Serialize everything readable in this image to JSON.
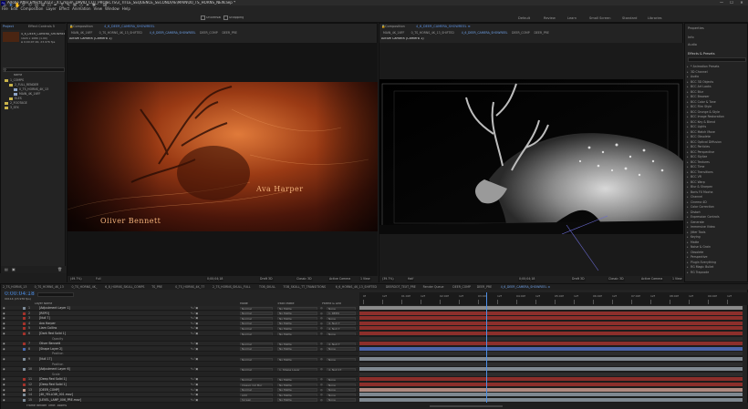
{
  "titlebar": {
    "title": "Adobe After Effects 2023 - X:\\_main\\_DAVID_CUT_PROJECTS\\3_TITLE_SEQUENCE_SECOND\\AE\\MAIN\\00_TS_HORNS_NEW.aep *",
    "icon": "Ae",
    "minimize": "—",
    "maximize": "☐",
    "close": "✕"
  },
  "menu": [
    "File",
    "Edit",
    "Composition",
    "Layer",
    "Effect",
    "Animation",
    "View",
    "Window",
    "Help"
  ],
  "toolbar": {
    "snapping": "Snapping",
    "universal": "Universal"
  },
  "workspaces": [
    "Default",
    "Review",
    "Learn",
    "Small Screen",
    "Standard",
    "Libraries"
  ],
  "project": {
    "tabs": [
      "Project",
      "Effect Controls 5"
    ],
    "comp_name": "4_6_DEER_CAMERA_SHOWREEL",
    "comp_info": "1920 x 1080 (1.00)",
    "comp_info2": "Δ 0;00;07;00, 23.976 fps",
    "search": "",
    "column": "Name",
    "items": [
      {
        "name": "1_COMPS",
        "color": "#c9b34a",
        "indent": 0
      },
      {
        "name": "2_FULL_RENDER",
        "color": "#c9b34a",
        "indent": 1
      },
      {
        "name": "0_TS_HORNS_4K_13",
        "color": "#8ea3c6",
        "indent": 2
      },
      {
        "name": "MAIN_4K_16FF",
        "color": "#8ea3c6",
        "indent": 2
      },
      {
        "name": "ELES",
        "color": "#c9b34a",
        "indent": 1
      },
      {
        "name": "2_FOOTAGE",
        "color": "#c9b34a",
        "indent": 0
      },
      {
        "name": "3_SFX",
        "color": "#c9b34a",
        "indent": 0
      }
    ]
  },
  "viewer_left": {
    "header": "Composition",
    "header_comp": "4_6_DEER_CAMERA_SHOWREEL",
    "tabs": [
      "MAIN_4K_16FF",
      "0_TS_HORNS_4K_13_SHIFTED",
      "4_6_DEER_CAMERA_SHOWREEL",
      "DEER_COMP",
      "DEER_PRE"
    ],
    "active_index": 2,
    "camera": "Active Camera (Camera 1)",
    "text1": "Oliver Bennett",
    "text2": "Ava Harper",
    "bottom": [
      "(49.7%)",
      "Full",
      "0;00;04;18",
      "Draft 3D",
      "Classic 3D",
      "Active Camera",
      "1 View"
    ]
  },
  "viewer_right": {
    "header": "Composition",
    "header_comp": "4_6_DEER_CAMERA_SHOWREEL ≡",
    "tabs": [
      "MAIN_4K_16FF",
      "0_TS_HORNS_4K_13_SHIFTED",
      "4_6_DEER_CAMERA_SHOWREEL",
      "DEER_COMP",
      "DEER_PRE"
    ],
    "active_index": 2,
    "camera": "Active Camera (Camera 1)",
    "bottom": [
      "(39.7%)",
      "Half",
      "0;00;04;18",
      "Draft 3D",
      "Classic 3D",
      "Active Camera",
      "1 View"
    ]
  },
  "right_panel": {
    "sections": [
      "Properties",
      "Info",
      "Audio"
    ],
    "effects_title": "Effects & Presets",
    "effects": [
      "* Animation Presets",
      "3D Channel",
      "Audio",
      "BCC 3D Objects",
      "BCC Art Looks",
      "BCC Blur",
      "BCC Browser",
      "BCC Color & Tone",
      "BCC Film Style",
      "BCC Grunge & Style",
      "BCC Image Restoration",
      "BCC Key & Blend",
      "BCC Lights",
      "BCC Match Move",
      "BCC Obsolete",
      "BCC Optical Diffusion",
      "BCC Particles",
      "BCC Perspective",
      "BCC Stylize",
      "BCC Textures",
      "BCC Time",
      "BCC Transitions",
      "BCC VR",
      "BCC Warp",
      "Blur & Sharpen",
      "Boris FX Mocha",
      "Channel",
      "Cinema 4D",
      "Color Correction",
      "Distort",
      "Expression Controls",
      "Generate",
      "Immersive Video",
      "Jitter Tools",
      "Keying",
      "Matte",
      "Noise & Grain",
      "Obsolete",
      "Perspective",
      "Plugin Everything",
      "RG Magic Bullet",
      "RG Trapcode"
    ]
  },
  "timeline": {
    "tabs": [
      "2_TS_HORNS_13",
      "0_TS_HORNS_4K_13",
      "0_TS_HORNS_4K_",
      "6_8_HORNS_SKULL_COMPS",
      "TS_PRE",
      "0_TS_HORNS_4K_77",
      "2_TS_HORNS_SKULL_FULL",
      "TOB_SKULL",
      "TOB_SKULL_TT_TRANSITIONS",
      "6_6_HORNS_4K_13_SHIFTED",
      "DEERDOT_TEXT_PRE",
      "Render Queue",
      "DEER_COMP",
      "DEER_PRE",
      "4_6_DEER_CAMERA_SHOWREEL ≡"
    ],
    "active_tab": 14,
    "timecode": "0:00:04:18",
    "frame_info": "00114 (23.976 fps)",
    "col_name": "Layer Name",
    "col_mode": "Mode",
    "col_track": "Track Matte",
    "col_parent": "Parent & Link",
    "ruler": [
      "0f",
      "12f",
      "01:00f",
      "12f",
      "02:00f",
      "12f",
      "03:00f",
      "12f",
      "04:00f",
      "12f",
      "05:00f",
      "12f",
      "06:00f",
      "12f",
      "07:00f",
      "12f",
      "08:00f",
      "12f",
      "09:00f",
      "12f"
    ],
    "current_time_fraction": 0.33,
    "footer": "Frame Render Time: 388ms",
    "layers": [
      {
        "num": "1",
        "name": "[Adjustment Layer 1]",
        "color": "#7e8c99",
        "mode": "Normal",
        "matte": "No Matte",
        "parent": "None",
        "bar": "#8a8a8a"
      },
      {
        "num": "2",
        "name": "[REPO]",
        "color": "#a3322b",
        "mode": "Normal",
        "matte": "No Matte",
        "parent": "1. REPO",
        "bar": "#8c2f2b"
      },
      {
        "num": "3",
        "name": "[Null 7]",
        "color": "#a3322b",
        "mode": "Normal",
        "matte": "No Matte",
        "parent": "None",
        "bar": "#8c2f2b"
      },
      {
        "num": "4",
        "name": "Ava Harper",
        "color": "#a3322b",
        "mode": "Normal",
        "matte": "No Matte",
        "parent": "4. Null 7",
        "bar": "#8c2f2b"
      },
      {
        "num": "5",
        "name": "Liam Collins",
        "color": "#a3322b",
        "mode": "Normal",
        "matte": "No Matte",
        "parent": "4. Null 7",
        "bar": "#8c2f2b"
      },
      {
        "num": "6",
        "name": "[Dark Red Solid 1]",
        "color": "#a3322b",
        "mode": "Normal",
        "matte": "No Matte",
        "parent": "None",
        "bar": "#8c2f2b"
      },
      {
        "num": "",
        "name": "Opacity",
        "color": "",
        "mode": "",
        "matte": "",
        "parent": "",
        "bar": "#2d2d2d"
      },
      {
        "num": "7",
        "name": "Oliver Bennett",
        "color": "#a3322b",
        "mode": "Normal",
        "matte": "No Matte",
        "parent": "4. Null 7",
        "bar": "#8c2f2b"
      },
      {
        "num": "8",
        "name": "[Shape Layer 2]",
        "color": "#4a6bb0",
        "mode": "Normal",
        "matte": "No Matte",
        "parent": "None",
        "bar": "#4b64a8"
      },
      {
        "num": "",
        "name": "Position",
        "color": "",
        "mode": "",
        "matte": "",
        "parent": "",
        "bar": "#2d2d2d"
      },
      {
        "num": "9",
        "name": "[Null 17]",
        "color": "#7e8c99",
        "mode": "Normal",
        "matte": "No Matte",
        "parent": "None",
        "bar": "#7f8890"
      },
      {
        "num": "",
        "name": "Position",
        "color": "",
        "mode": "",
        "matte": "",
        "parent": "",
        "bar": "#2d2d2d"
      },
      {
        "num": "10",
        "name": "[Adjustment Layer 6]",
        "color": "#7e8c99",
        "mode": "Normal",
        "matte": "1. Shape Layer",
        "parent": "4. Null 17",
        "bar": "#7f8890"
      },
      {
        "num": "",
        "name": "Scale",
        "color": "",
        "mode": "",
        "matte": "",
        "parent": "",
        "bar": "#2d2d2d"
      },
      {
        "num": "11",
        "name": "[Deep Red Solid 1]",
        "color": "#a3322b",
        "mode": "Normal",
        "matte": "No Matte",
        "parent": "None",
        "bar": "#8c2f2b"
      },
      {
        "num": "12",
        "name": "[Deep Red Solid 1]",
        "color": "#a3322b",
        "mode": "Classic Col Bur",
        "matte": "No Matte",
        "parent": "None",
        "bar": "#8c2f2b"
      },
      {
        "num": "13",
        "name": "[DEER_COMP]",
        "color": "#c29a8d",
        "mode": "Normal",
        "matte": "No Matte",
        "parent": "None",
        "bar": "#b08a80"
      },
      {
        "num": "14",
        "name": "[4K_YELLOW_001.mov]",
        "color": "#7e8c99",
        "mode": "Add",
        "matte": "No Matte",
        "parent": "None",
        "bar": "#7f8890"
      },
      {
        "num": "15",
        "name": "[LEVEL_LAMP_006_PRE.mov]",
        "color": "#7e8c99",
        "mode": "Screen",
        "matte": "No Matte",
        "parent": "None",
        "bar": "#7f8890"
      }
    ]
  }
}
